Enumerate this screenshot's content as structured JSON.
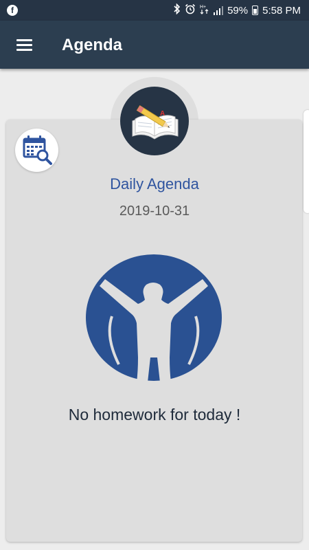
{
  "status_bar": {
    "app_icon": "facebook-icon",
    "battery": "59%",
    "time": "5:58 PM",
    "icons": [
      "bluetooth-icon",
      "alarm-icon",
      "hd-icon",
      "signal-icon",
      "battery-icon"
    ]
  },
  "toolbar": {
    "title": "Agenda",
    "menu_icon": "hamburger-menu-icon"
  },
  "card": {
    "badge_icon": "book-pencil-icon",
    "calendar_search_icon": "calendar-search-icon",
    "title": "Daily Agenda",
    "date": "2019-10-31",
    "illustration": "celebrating-person-icon",
    "message": "No homework for today !"
  },
  "colors": {
    "toolbar": "#2c3e50",
    "status_bar": "#263445",
    "accent_blue": "#2f549f",
    "illustration_blue": "#2a5192",
    "card": "#dedede",
    "background": "#ededed"
  }
}
